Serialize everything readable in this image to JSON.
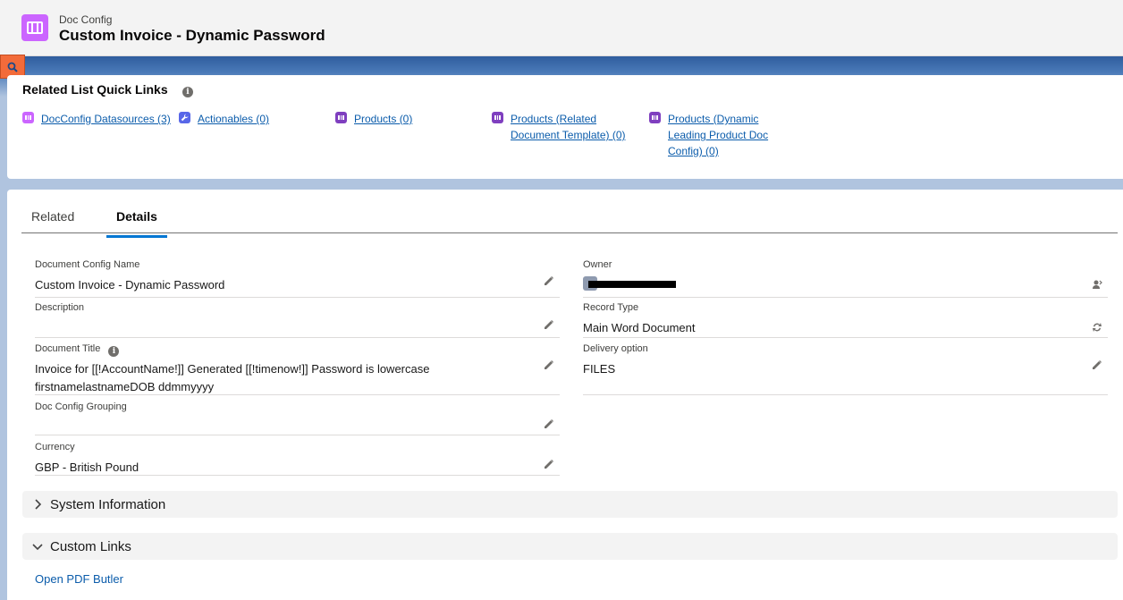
{
  "header": {
    "object_label": "Doc Config",
    "title": "Custom Invoice - Dynamic Password",
    "icon": "doc-config-icon",
    "icon_color": "#cb65ff"
  },
  "search_tab_icon": "search-icon",
  "quick_links": {
    "heading": "Related List Quick Links",
    "info_icon": "i",
    "items": [
      {
        "label": "DocConfig Datasources (3)",
        "icon": "datasource-icon",
        "color": "#cb65ff"
      },
      {
        "label": "Actionables (0)",
        "icon": "wrench-icon",
        "color": "#5867e8"
      },
      {
        "label": "Products (0)",
        "icon": "product-icon",
        "color": "#7f3fbf"
      },
      {
        "label_line1": "Products (Related",
        "label_line2": "Document Template) (0)",
        "icon": "product-icon",
        "color": "#7f3fbf"
      },
      {
        "label_line1": "Products (Dynamic",
        "label_line2": "Leading Product Doc",
        "label_line3": "Config) (0)",
        "icon": "product-icon",
        "color": "#7f3fbf"
      }
    ]
  },
  "tabs": [
    {
      "label": "Related",
      "active": false
    },
    {
      "label": "Details",
      "active": true
    }
  ],
  "fields": {
    "doc_config_name": {
      "label": "Document Config Name",
      "value": "Custom Invoice - Dynamic Password"
    },
    "description": {
      "label": "Description",
      "value": ""
    },
    "document_title": {
      "label": "Document Title",
      "value_line1": "Invoice for [[!AccountName!]] Generated [[!timenow!]] Password is lowercase",
      "value_line2": "firstnamelastnameDOB ddmmyyyy"
    },
    "grouping": {
      "label": "Doc Config Grouping",
      "value": ""
    },
    "currency": {
      "label": "Currency",
      "value": "GBP - British Pound"
    },
    "owner": {
      "label": "Owner",
      "value": ""
    },
    "record_type": {
      "label": "Record Type",
      "value": "Main Word Document"
    },
    "delivery_option": {
      "label": "Delivery option",
      "value": "FILES"
    }
  },
  "sections": {
    "system_information": {
      "label": "System Information",
      "expanded": false
    },
    "custom_links": {
      "label": "Custom Links",
      "expanded": true
    }
  },
  "custom_links": {
    "open_pdf_butler": "Open PDF Butler"
  },
  "colors": {
    "link": "#0b5cab",
    "active_tab": "#0176d3"
  }
}
